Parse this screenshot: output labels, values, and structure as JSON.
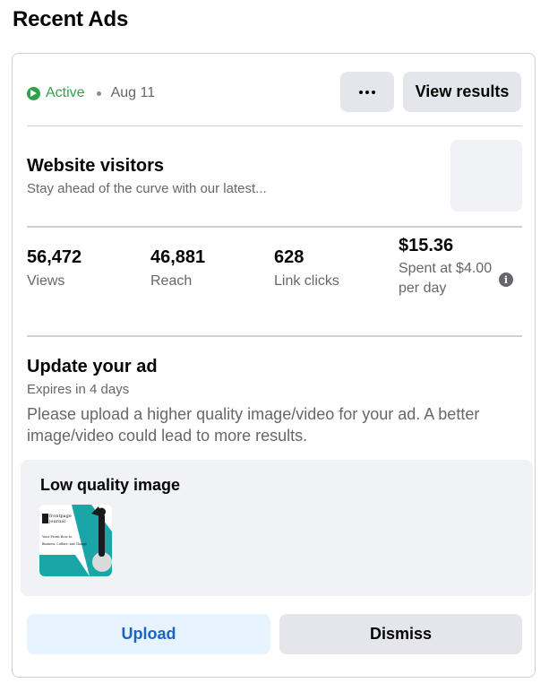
{
  "page_title": "Recent Ads",
  "ad": {
    "status": "Active",
    "date": "Aug 11",
    "more_icon": "more-horizontal-icon",
    "view_results_label": "View results",
    "title": "Website visitors",
    "description": "Stay ahead of the curve with our latest...",
    "status_color": "#31a24c"
  },
  "metrics": [
    {
      "value": "56,472",
      "label": "Views"
    },
    {
      "value": "46,881",
      "label": "Reach"
    },
    {
      "value": "628",
      "label": "Link clicks"
    },
    {
      "value": "$15.36",
      "label_line1": "Spent at $4.00",
      "label_line2": "per day"
    }
  ],
  "update": {
    "title": "Update your ad",
    "expires": "Expires in 4 days",
    "message": "Please upload a higher quality image/video for your ad. A better image/video could lead to more results.",
    "quality_title": "Low quality image",
    "image_text": {
      "brand_line1": "frontpage",
      "brand_line2": "journal",
      "headline_line1": "Your Front Row to",
      "headline_line2": "Business, Culture, and Change"
    },
    "upload_label": "Upload",
    "dismiss_label": "Dismiss"
  },
  "colors": {
    "accent_blue": "#1b64c4",
    "upload_bg": "#e7f3ff",
    "button_gray": "#e4e6eb",
    "teal": "#1aa6a6"
  }
}
